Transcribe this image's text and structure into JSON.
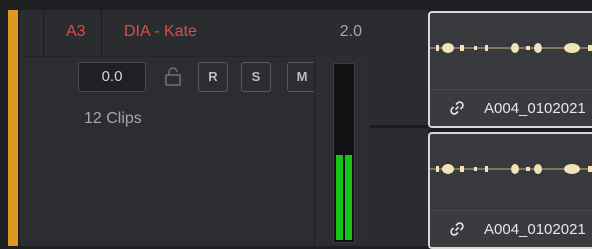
{
  "track": {
    "id": "A3",
    "name": "DIA - Kate",
    "channels": "2.0",
    "volume": "0.0",
    "record_label": "R",
    "solo_label": "S",
    "mute_label": "M",
    "clip_count": "12 Clips",
    "color": "#d99a1f",
    "meter_level_left": 0.49,
    "meter_level_right": 0.49
  },
  "clips": [
    {
      "name": "A004_0102021"
    },
    {
      "name": "A004_0102021"
    }
  ],
  "icons": [
    "lock-icon",
    "link-icon"
  ]
}
